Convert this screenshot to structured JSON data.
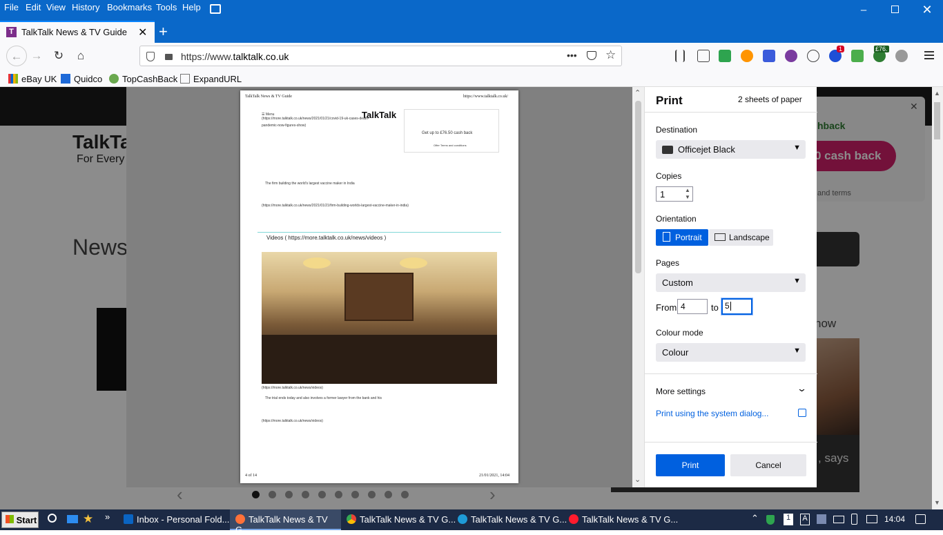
{
  "menu": [
    "File",
    "Edit",
    "View",
    "History",
    "Bookmarks",
    "Tools",
    "Help"
  ],
  "tab": {
    "favicon": "T",
    "title": "TalkTalk News & TV Guide",
    "close": "✕"
  },
  "urlbar": {
    "prefix": "https://www.",
    "domain": "talktalk.co.uk",
    "more": "•••"
  },
  "toolbar_badges": {
    "notifications": "1",
    "cashback": "£76."
  },
  "bookmarks": [
    "eBay UK",
    "Quidco",
    "TopCashBack",
    "ExpandURL"
  ],
  "page_bg": {
    "logo1": "TalkTa",
    "logo2": "For Every",
    "news": "News",
    "cashback_banner": "hback",
    "cashback_button": "0 cash back",
    "terms": "and terms",
    "now": "now",
    "says": ", says"
  },
  "sheet": {
    "header_left": "TalkTalk News & TV Guide",
    "header_right": "https://www.talktalk.co.uk/",
    "menu": "Menu",
    "logo": "TalkTalk",
    "link1a": "(https://more.talktalk.co.uk/news/2021/01/21/covid-19-uk-cases-death-",
    "link1b": "pandemic-now-figures-show)",
    "ad_text": "Get up to £76.50 cash back",
    "ad_small": "Offer Terms and conditions",
    "headline2": "The firm building the world's largest vaccine maker in India",
    "link2": "(https://more.talktalk.co.uk/news/2021/01/21/firm-building-worlds-largest-vaccine-maker-in-india)",
    "videos_heading": "Videos ( https://more.talktalk.co.uk/news/videos )",
    "link3": "(https://more.talktalk.co.uk/news/videos)",
    "caption": "The trial ends today and also involves a former lawyer from the bank and his",
    "link4": "(https://more.talktalk.co.uk/news/videos)",
    "footer_left": "4 of 14",
    "footer_right": "21/01/2021, 14:04"
  },
  "print": {
    "title": "Print",
    "sheets": "2 sheets of paper",
    "destination_label": "Destination",
    "destination": "Officejet Black",
    "copies_label": "Copies",
    "copies": "1",
    "orientation_label": "Orientation",
    "portrait": "Portrait",
    "landscape": "Landscape",
    "pages_label": "Pages",
    "pages": "Custom",
    "from_label": "From",
    "from_value": "4",
    "to_label": "to",
    "to_value": "5",
    "colour_label": "Colour mode",
    "colour": "Colour",
    "more_settings": "More settings",
    "system_dialog": "Print using the system dialog...",
    "print_btn": "Print",
    "cancel_btn": "Cancel"
  },
  "preview_nav": {
    "prev": "‹",
    "next": "›",
    "dot_count": 10,
    "active": 0
  },
  "taskbar": {
    "start": "Start",
    "tasks": [
      "Inbox - Personal Fold...",
      "TalkTalk News & TV G...",
      "TalkTalk News & TV G...",
      "TalkTalk News & TV G...",
      "TalkTalk News & TV G..."
    ],
    "clock": "14:04"
  },
  "colors": {
    "accent": "#0060df",
    "titlebar": "#0a68c9",
    "taskbar": "#1c2a45"
  }
}
